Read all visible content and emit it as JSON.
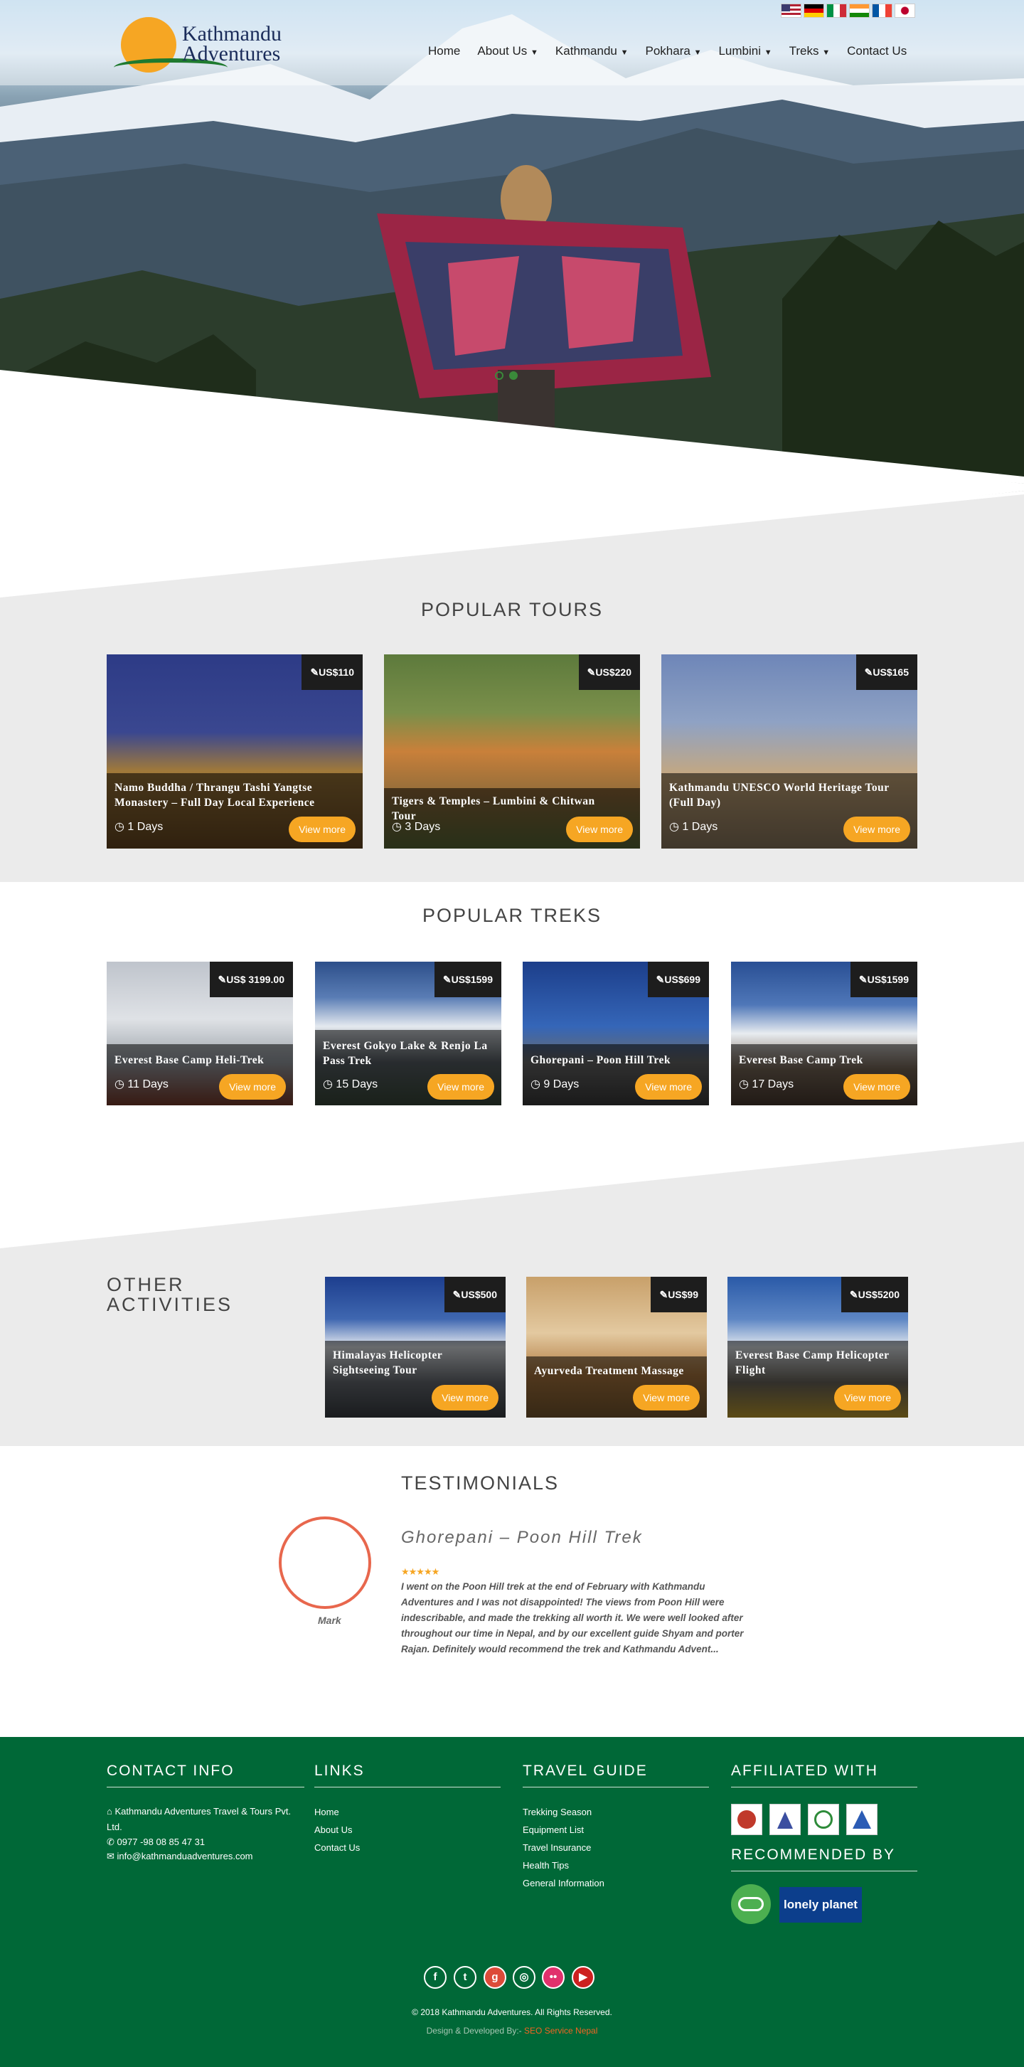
{
  "header": {
    "brand_line1": "Kathmandu",
    "brand_line2": "Adventures",
    "nav": [
      {
        "label": "Home",
        "dropdown": false
      },
      {
        "label": "About Us",
        "dropdown": true
      },
      {
        "label": "Kathmandu",
        "dropdown": true
      },
      {
        "label": "Pokhara",
        "dropdown": true
      },
      {
        "label": "Lumbini",
        "dropdown": true
      },
      {
        "label": "Treks",
        "dropdown": true
      },
      {
        "label": "Contact Us",
        "dropdown": false
      }
    ],
    "flags": [
      "usa",
      "germany",
      "italy",
      "india",
      "france",
      "japan"
    ]
  },
  "popular_tours": {
    "title": "POPULAR TOURS",
    "items": [
      {
        "price": "US$110",
        "title": "Namo Buddha / Thrangu Tashi Yangtse Monastery – Full Day Local Experience",
        "duration": "1 Days",
        "button": "View more"
      },
      {
        "price": "US$220",
        "title": "Tigers & Temples – Lumbini & Chitwan Tour",
        "duration": "3 Days",
        "button": "View more"
      },
      {
        "price": "US$165",
        "title": "Kathmandu UNESCO World Heritage Tour (Full Day)",
        "duration": "1 Days",
        "button": "View more"
      }
    ]
  },
  "popular_treks": {
    "title": "POPULAR TREKS",
    "items": [
      {
        "price": "US$ 3199.00",
        "title": "Everest Base Camp Heli-Trek",
        "duration": "11 Days",
        "button": "View more"
      },
      {
        "price": "US$1599",
        "title": "Everest Gokyo Lake & Renjo La Pass Trek",
        "duration": "15 Days",
        "button": "View more"
      },
      {
        "price": "US$699",
        "title": "Ghorepani – Poon Hill Trek",
        "duration": "9 Days",
        "button": "View more"
      },
      {
        "price": "US$1599",
        "title": "Everest Base Camp Trek",
        "duration": "17 Days",
        "button": "View more"
      }
    ]
  },
  "other_activities": {
    "title_line1": "OTHER",
    "title_line2": "ACTIVITIES",
    "items": [
      {
        "price": "US$500",
        "title": "Himalayas Helicopter Sightseeing Tour",
        "button": "View more"
      },
      {
        "price": "US$99",
        "title": "Ayurveda Treatment Massage",
        "button": "View more"
      },
      {
        "price": "US$5200",
        "title": "Everest Base Camp Helicopter Flight",
        "button": "View more"
      }
    ]
  },
  "testimonials": {
    "title": "TESTIMONIALS",
    "trip": "Ghorepani – Poon Hill Trek",
    "rating": 5,
    "stars": "★★★★★",
    "author": "Mark",
    "quote": "I went on the Poon Hill trek at the end of February with Kathmandu Adventures and I was not disappointed! The views from Poon Hill were indescribable, and made the trekking all worth it. We were well looked after throughout our time in Nepal, and by our excellent guide Shyam and porter Rajan. Definitely would recommend the trek and Kathmandu Advent..."
  },
  "footer": {
    "contact": {
      "title": "CONTACT INFO",
      "company_line1": "Kathmandu Adventures Travel & Tours Pvt.",
      "company_line2": "Ltd.",
      "phone": "0977 -98 08 85 47 31",
      "email": "info@kathmanduadventures.com"
    },
    "links": {
      "title": "LINKS",
      "items": [
        "Home",
        "About Us",
        "Contact Us"
      ]
    },
    "travel_guide": {
      "title": "TRAVEL GUIDE",
      "items": [
        "Trekking Season",
        "Equipment List",
        "Travel Insurance",
        "Health Tips",
        "General Information"
      ]
    },
    "affiliated": {
      "title": "AFFILIATED WITH"
    },
    "recommended": {
      "title": "RECOMMENDED BY",
      "lonely_planet": "lonely planet"
    },
    "social": [
      "facebook-icon",
      "twitter-icon",
      "google-plus-icon",
      "instagram-icon",
      "flickr-icon",
      "youtube-icon"
    ],
    "copyright": "© 2018 Kathmandu Adventures. All Rights Reserved.",
    "credit_prefix": "Design & Developed By:-",
    "credit_link": "SEO Service Nepal"
  },
  "colors": {
    "accent": "#f6a623",
    "footer_bg": "#006837",
    "section_grey": "#ebebeb",
    "testimonial_ring": "#e8674d",
    "credit_link": "#f26522"
  }
}
